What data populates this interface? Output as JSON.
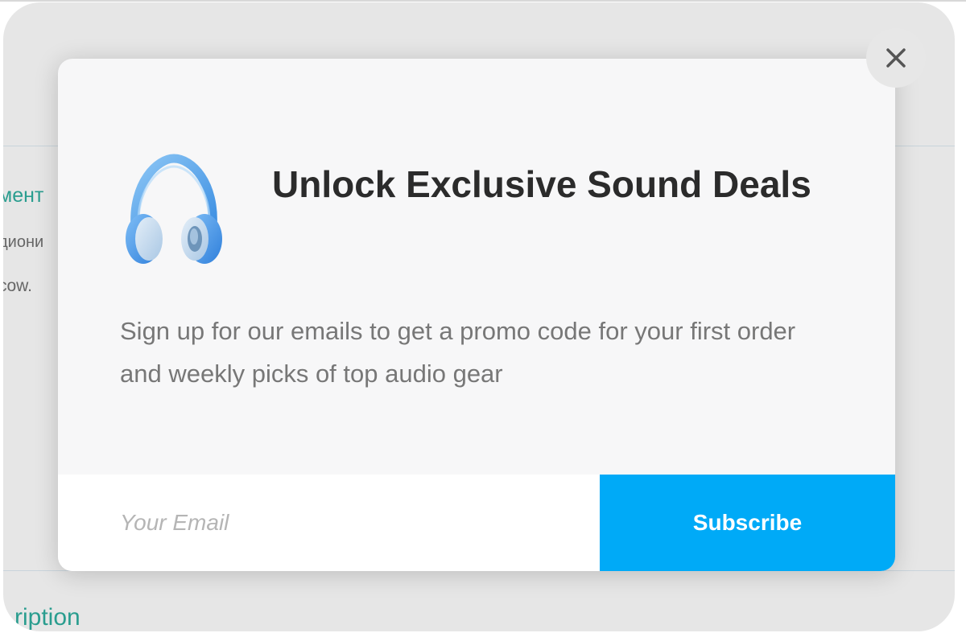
{
  "background": {
    "line1": "мент",
    "line2": "диони",
    "line3": "cow.",
    "description_label": "ription"
  },
  "modal": {
    "close_icon": "close-icon",
    "hero_icon": "headphones-icon",
    "title": "Unlock Exclusive Sound Deals",
    "description": "Sign up for our emails to get a promo code for your first order and weekly picks of top audio gear",
    "email": {
      "placeholder": "Your Email",
      "value": ""
    },
    "subscribe_label": "Subscribe"
  },
  "colors": {
    "accent": "#00aaf7",
    "background_link": "#2a9d8f",
    "title": "#2b2b2b",
    "description": "#777777"
  }
}
